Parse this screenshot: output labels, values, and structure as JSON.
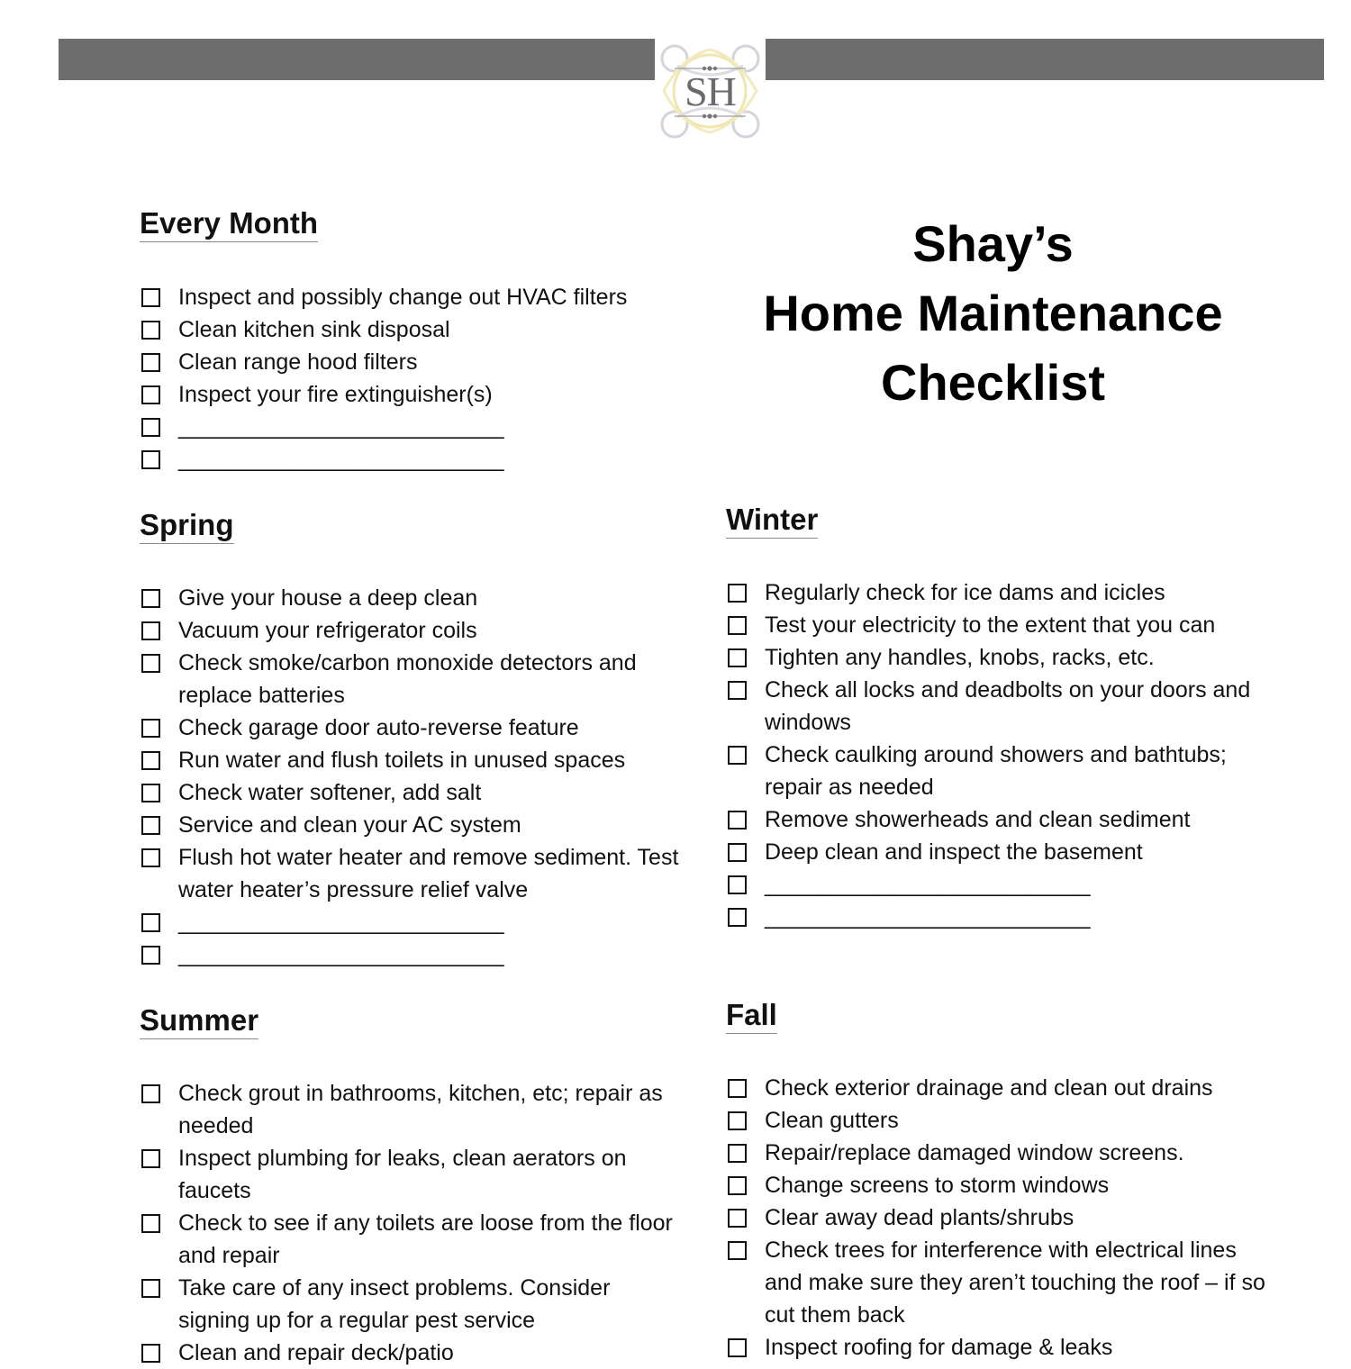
{
  "header": {
    "logo_monogram": "SH",
    "logo_icon": "ornamental-monogram-logo",
    "bar_color": "#6d6d6d"
  },
  "title": {
    "line1": "Shay’s",
    "line2": "Home Maintenance",
    "line3": "Checklist"
  },
  "sections": {
    "every_month": {
      "heading": "Every Month",
      "items": [
        "Inspect and possibly change out HVAC filters",
        "Clean kitchen sink disposal",
        "Clean range hood filters",
        "Inspect your fire extinguisher(s)",
        "__________________________",
        "__________________________"
      ]
    },
    "spring": {
      "heading": "Spring",
      "items": [
        "Give your house a deep clean",
        "Vacuum your refrigerator coils",
        "Check smoke/carbon monoxide detectors and replace batteries",
        "Check garage door auto-reverse feature",
        "Run water and flush toilets in unused spaces",
        "Check water softener, add salt",
        "Service and clean your AC system",
        "Flush hot water heater and remove sediment. Test water heater’s pressure relief valve",
        "__________________________",
        "__________________________"
      ]
    },
    "summer": {
      "heading": "Summer",
      "items": [
        "Check grout in bathrooms, kitchen, etc; repair as needed",
        "Inspect plumbing for leaks, clean aerators on faucets",
        "Check to see if any toilets are loose from the floor and repair",
        "Take care of any insect problems. Consider signing up for a regular pest service",
        "Clean and repair deck/patio"
      ]
    },
    "winter": {
      "heading": "Winter",
      "items": [
        "Regularly check for ice dams and icicles",
        "Test your electricity to the extent that you can",
        "Tighten any handles, knobs, racks, etc.",
        "Check all locks and deadbolts on your doors and windows",
        "Check caulking around showers and bathtubs; repair as needed",
        "Remove showerheads and clean sediment",
        "Deep clean and inspect the basement",
        "__________________________",
        "__________________________"
      ]
    },
    "fall": {
      "heading": "Fall",
      "items": [
        "Check exterior drainage and clean out drains",
        "Clean gutters",
        "Repair/replace damaged window screens.",
        "Change screens to storm windows",
        "Clear away dead plants/shrubs",
        "Check trees for interference with electrical lines and make sure they aren’t touching the roof – if so cut them back",
        "Inspect roofing for damage & leaks"
      ]
    }
  }
}
